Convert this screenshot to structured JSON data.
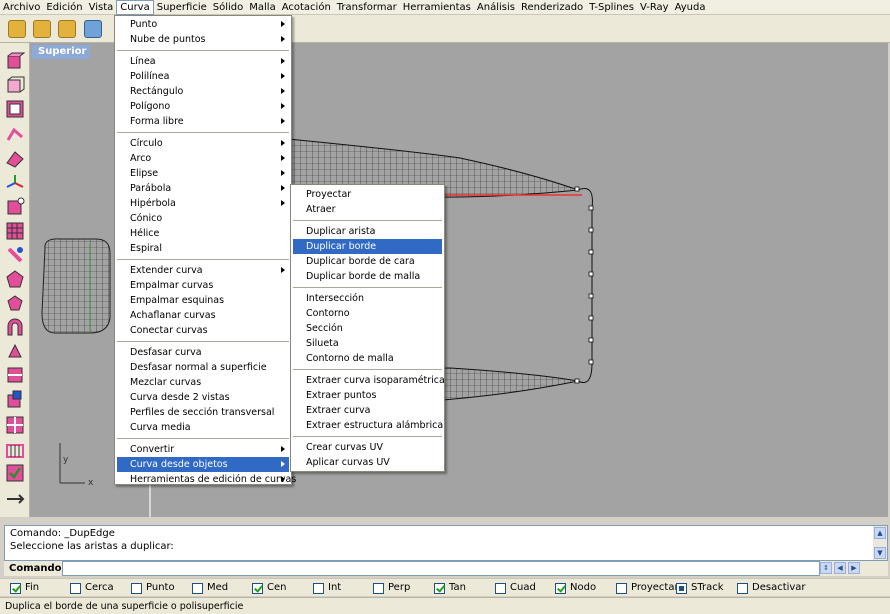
{
  "menubar": {
    "items": [
      "Archivo",
      "Edición",
      "Vista",
      "Curva",
      "Superficie",
      "Sólido",
      "Malla",
      "Acotación",
      "Transformar",
      "Herramientas",
      "Análisis",
      "Renderizado",
      "T-Splines",
      "V-Ray",
      "Ayuda"
    ],
    "active": "Curva"
  },
  "viewport": {
    "title": "Superior",
    "axis_x": "x",
    "axis_y": "y"
  },
  "curva_menu": {
    "items": [
      {
        "label": "Punto",
        "submenu": true
      },
      {
        "label": "Nube de puntos",
        "submenu": true
      },
      {
        "label": "Línea",
        "submenu": true
      },
      {
        "label": "Polilínea",
        "submenu": true
      },
      {
        "label": "Rectángulo",
        "submenu": true
      },
      {
        "label": "Polígono",
        "submenu": true
      },
      {
        "label": "Forma libre",
        "submenu": true
      },
      {
        "label": "Círculo",
        "submenu": true
      },
      {
        "label": "Arco",
        "submenu": true
      },
      {
        "label": "Elipse",
        "submenu": true
      },
      {
        "label": "Parábola",
        "submenu": true
      },
      {
        "label": "Hipérbola",
        "submenu": true
      },
      {
        "label": "Cónico",
        "submenu": false
      },
      {
        "label": "Hélice",
        "submenu": false
      },
      {
        "label": "Espiral",
        "submenu": false
      },
      {
        "label": "Extender curva",
        "submenu": true
      },
      {
        "label": "Empalmar curvas",
        "submenu": false
      },
      {
        "label": "Empalmar esquinas",
        "submenu": false
      },
      {
        "label": "Achaflanar curvas",
        "submenu": false
      },
      {
        "label": "Conectar curvas",
        "submenu": false
      },
      {
        "label": "Desfasar curva",
        "submenu": false
      },
      {
        "label": "Desfasar normal a superficie",
        "submenu": false
      },
      {
        "label": "Mezclar curvas",
        "submenu": false
      },
      {
        "label": "Curva desde 2 vistas",
        "submenu": false
      },
      {
        "label": "Perfiles de sección transversal",
        "submenu": false
      },
      {
        "label": "Curva media",
        "submenu": false
      },
      {
        "label": "Convertir",
        "submenu": true
      },
      {
        "label": "Curva desde objetos",
        "submenu": true,
        "highlighted": true
      },
      {
        "label": "Herramientas de edición de curvas",
        "submenu": true
      }
    ]
  },
  "objetos_submenu": {
    "items": [
      {
        "label": "Proyectar"
      },
      {
        "label": "Atraer"
      },
      {
        "label": "Duplicar arista"
      },
      {
        "label": "Duplicar borde",
        "highlighted": true
      },
      {
        "label": "Duplicar borde de cara"
      },
      {
        "label": "Duplicar borde de malla"
      },
      {
        "label": "Intersección"
      },
      {
        "label": "Contorno"
      },
      {
        "label": "Sección"
      },
      {
        "label": "Silueta"
      },
      {
        "label": "Contorno de malla"
      },
      {
        "label": "Extraer curva isoparamétrica"
      },
      {
        "label": "Extraer puntos"
      },
      {
        "label": "Extraer curva"
      },
      {
        "label": "Extraer estructura alámbrica"
      },
      {
        "label": "Crear curvas UV"
      },
      {
        "label": "Aplicar curvas UV"
      }
    ]
  },
  "command_history": {
    "line1": "Comando: _DupEdge",
    "line2": "Seleccione las aristas a duplicar:"
  },
  "command_line": {
    "label": "Comando:",
    "value": ""
  },
  "osnaps": [
    {
      "label": "Fin",
      "checked": true
    },
    {
      "label": "Cerca",
      "checked": false
    },
    {
      "label": "Punto",
      "checked": false
    },
    {
      "label": "Med",
      "checked": false
    },
    {
      "label": "Cen",
      "checked": true
    },
    {
      "label": "Int",
      "checked": false
    },
    {
      "label": "Perp",
      "checked": false
    },
    {
      "label": "Tan",
      "checked": true
    },
    {
      "label": "Cuad",
      "checked": false
    },
    {
      "label": "Nodo",
      "checked": true
    },
    {
      "label": "Proyectar",
      "checked": false
    },
    {
      "label": "STrack",
      "checked": true,
      "style": "filled"
    },
    {
      "label": "Desactivar",
      "checked": false
    }
  ],
  "status": {
    "text": "Duplica el borde de una superficie o polisuperficie"
  },
  "colors": {
    "menu_highlight": "#316ac5",
    "viewport_bg": "#a3a3a3",
    "viewport_title_bg": "#8ca9d8"
  }
}
